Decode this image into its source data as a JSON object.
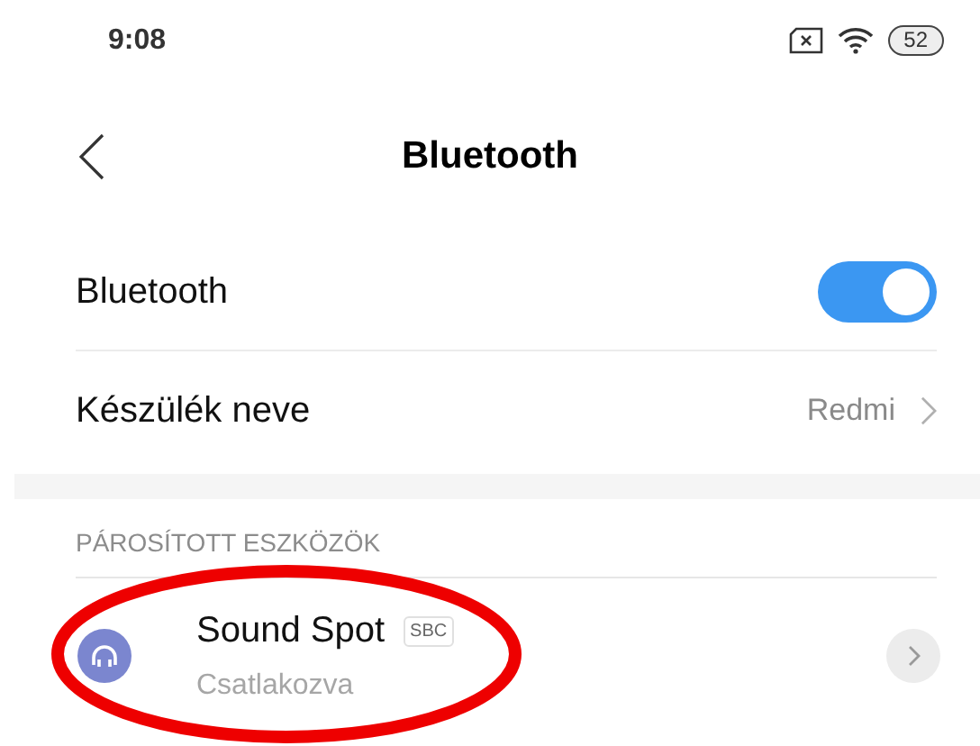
{
  "status_bar": {
    "time": "9:08",
    "battery": "52"
  },
  "header": {
    "title": "Bluetooth"
  },
  "settings": [
    {
      "kind": "toggle",
      "label": "Bluetooth",
      "on": true
    },
    {
      "kind": "link",
      "label": "Készülék neve",
      "value": "Redmi"
    }
  ],
  "paired_devices": {
    "heading": "PÁROSÍTOTT ESZKÖZÖK",
    "devices": [
      {
        "name": "Sound Spot",
        "codec": "SBC",
        "status": "Csatlakozva",
        "highlighted": true
      }
    ]
  }
}
